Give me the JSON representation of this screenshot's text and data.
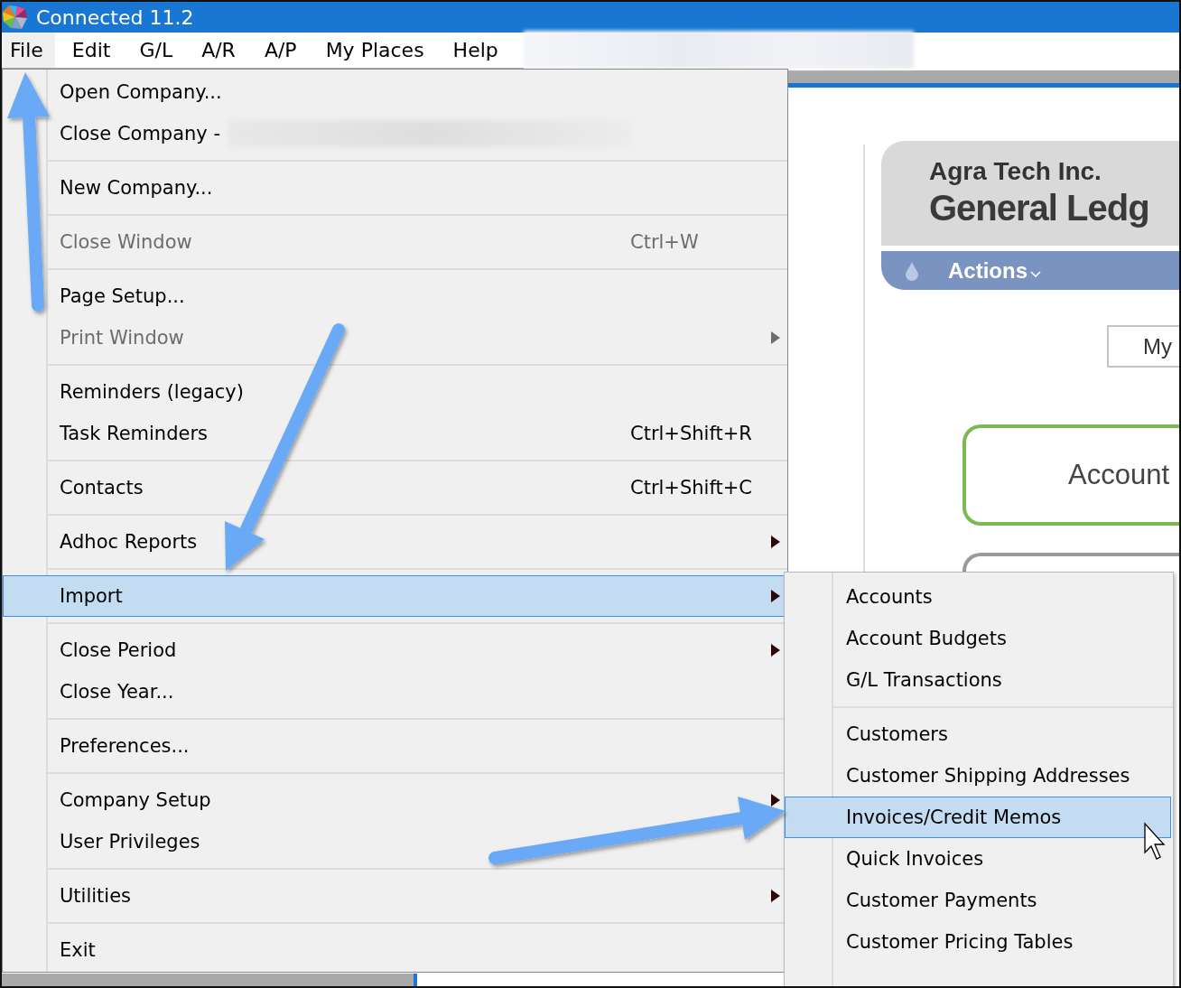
{
  "window": {
    "title": "Connected 11.2",
    "menu_redacted": true
  },
  "menu_bar": [
    {
      "label": "File",
      "selected": true
    },
    {
      "label": "Edit",
      "selected": false
    },
    {
      "label": "G/L",
      "selected": false
    },
    {
      "label": "A/R",
      "selected": false
    },
    {
      "label": "A/P",
      "selected": false
    },
    {
      "label": "My Places",
      "selected": false
    },
    {
      "label": "Help",
      "selected": false
    }
  ],
  "background": {
    "company": "Agra Tech Inc.",
    "module": "General Ledg",
    "actions": "Actions",
    "button": "My",
    "card": "Account"
  },
  "file_menu": {
    "groups": [
      [
        {
          "label": "Open Company...",
          "disabled": false,
          "submenu": false,
          "selected": false,
          "redacted": false
        },
        {
          "label": "Close Company -",
          "disabled": false,
          "submenu": false,
          "selected": false,
          "redacted": true
        }
      ],
      [
        {
          "label": "New Company...",
          "disabled": false,
          "submenu": false,
          "selected": false,
          "redacted": false
        }
      ],
      [
        {
          "label": "Close Window",
          "shortcut": "Ctrl+W",
          "disabled": true,
          "submenu": false,
          "selected": false,
          "redacted": false
        }
      ],
      [
        {
          "label": "Page Setup...",
          "disabled": false,
          "submenu": false,
          "selected": false,
          "redacted": false
        },
        {
          "label": "Print Window",
          "disabled": true,
          "submenu": true,
          "selected": false,
          "redacted": false
        }
      ],
      [
        {
          "label": "Reminders (legacy)",
          "disabled": false,
          "submenu": false,
          "selected": false,
          "redacted": false
        },
        {
          "label": "Task Reminders",
          "shortcut": "Ctrl+Shift+R",
          "disabled": false,
          "submenu": false,
          "selected": false,
          "redacted": false
        }
      ],
      [
        {
          "label": "Contacts",
          "shortcut": "Ctrl+Shift+C",
          "disabled": false,
          "submenu": false,
          "selected": false,
          "redacted": false
        }
      ],
      [
        {
          "label": "Adhoc Reports",
          "disabled": false,
          "submenu": true,
          "selected": false,
          "redacted": false
        }
      ],
      [
        {
          "label": "Import",
          "disabled": false,
          "submenu": true,
          "selected": true,
          "redacted": false
        }
      ],
      [
        {
          "label": "Close Period",
          "disabled": false,
          "submenu": true,
          "selected": false,
          "redacted": false
        },
        {
          "label": "Close Year...",
          "disabled": false,
          "submenu": false,
          "selected": false,
          "redacted": false
        }
      ],
      [
        {
          "label": "Preferences...",
          "disabled": false,
          "submenu": false,
          "selected": false,
          "redacted": false
        }
      ],
      [
        {
          "label": "Company Setup",
          "disabled": false,
          "submenu": true,
          "selected": false,
          "redacted": false
        },
        {
          "label": "User Privileges",
          "disabled": false,
          "submenu": false,
          "selected": false,
          "redacted": false
        }
      ],
      [
        {
          "label": "Utilities",
          "disabled": false,
          "submenu": true,
          "selected": false,
          "redacted": false
        }
      ],
      [
        {
          "label": "Exit",
          "disabled": false,
          "submenu": false,
          "selected": false,
          "redacted": false
        }
      ]
    ]
  },
  "import_submenu": {
    "groups": [
      [
        {
          "label": "Accounts",
          "selected": false
        },
        {
          "label": "Account Budgets",
          "selected": false
        },
        {
          "label": "G/L Transactions",
          "selected": false
        }
      ],
      [
        {
          "label": "Customers",
          "selected": false
        },
        {
          "label": "Customer Shipping Addresses",
          "selected": false
        },
        {
          "label": "Invoices/Credit Memos",
          "selected": true
        },
        {
          "label": "Quick Invoices",
          "selected": false
        },
        {
          "label": "Customer Payments",
          "selected": false
        },
        {
          "label": "Customer Pricing Tables",
          "selected": false
        }
      ]
    ]
  }
}
